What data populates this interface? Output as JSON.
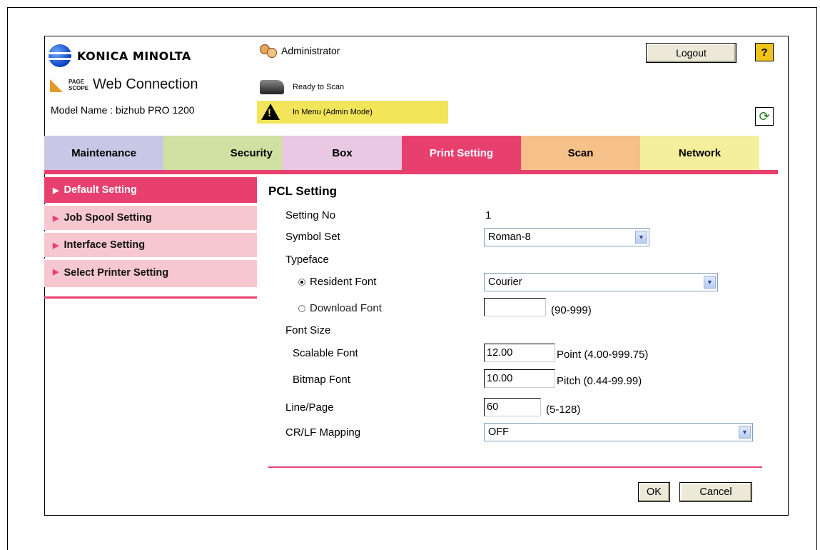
{
  "header": {
    "brand": "KONICA MINOLTA",
    "pagescope_line1": "PAGE",
    "pagescope_line2": "SCOPE",
    "web_connection": "Web Connection",
    "model_name": "Model Name : bizhub PRO 1200",
    "user": "Administrator",
    "logout_label": "Logout",
    "help_label": "?",
    "status_scan": "Ready to Scan",
    "status_menu": "In Menu (Admin Mode)",
    "status_menu_color": "#f2e55a"
  },
  "tabs": [
    {
      "label": "Maintenance",
      "color": "#c9c6e6"
    },
    {
      "label": "Security",
      "color": "#cfe0a2"
    },
    {
      "label": "Box",
      "color": "#e8c8e2"
    },
    {
      "label": "Print Setting",
      "color": "#e8406e",
      "active": true
    },
    {
      "label": "Scan",
      "color": "#f6c08a"
    },
    {
      "label": "Network",
      "color": "#f3ef9c"
    }
  ],
  "sidebar": {
    "items": [
      {
        "label": "Default Setting",
        "active": true
      },
      {
        "label": "Job Spool Setting"
      },
      {
        "label": "Interface Setting"
      },
      {
        "label": "Select Printer Setting"
      }
    ]
  },
  "form": {
    "title": "PCL Setting",
    "setting_no_label": "Setting No",
    "setting_no_value": "1",
    "symbol_set_label": "Symbol Set",
    "symbol_set_value": "Roman-8",
    "typeface_label": "Typeface",
    "resident_font_label": "Resident Font",
    "resident_font_value": "Courier",
    "download_font_label": "Download Font",
    "download_font_value": "",
    "download_font_range": "(90-999)",
    "font_size_label": "Font Size",
    "scalable_font_label": "Scalable Font",
    "scalable_font_value": "12.00",
    "scalable_font_unit": "Point (4.00-999.75)",
    "bitmap_font_label": "Bitmap Font",
    "bitmap_font_value": "10.00",
    "bitmap_font_unit": "Pitch (0.44-99.99)",
    "line_page_label": "Line/Page",
    "line_page_value": "60",
    "line_page_range": "(5-128)",
    "crlf_label": "CR/LF Mapping",
    "crlf_value": "OFF",
    "ok_label": "OK",
    "cancel_label": "Cancel"
  },
  "colors": {
    "accent": "#e8406e",
    "sidebar_inactive": "#f7c7d0"
  }
}
